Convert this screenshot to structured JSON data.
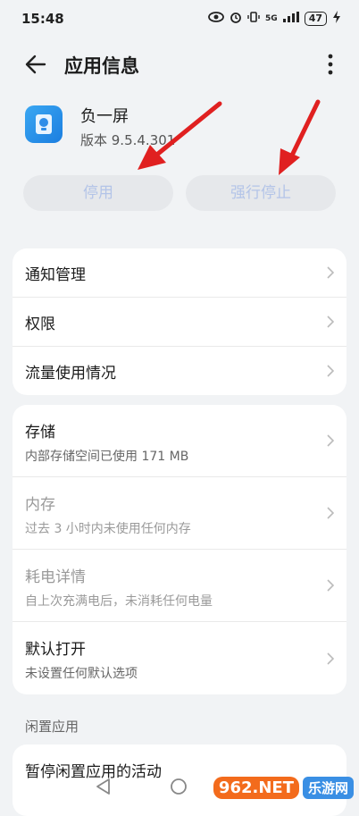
{
  "status_bar": {
    "time": "15:48",
    "network": "5G",
    "battery": "47"
  },
  "header": {
    "title": "应用信息"
  },
  "app": {
    "name": "负一屏",
    "version": "版本 9.5.4.301"
  },
  "actions": {
    "disable": "停用",
    "force_stop": "强行停止"
  },
  "card1": [
    {
      "label": "通知管理"
    },
    {
      "label": "权限"
    },
    {
      "label": "流量使用情况"
    }
  ],
  "card2": [
    {
      "label": "存储",
      "sub": "内部存储空间已使用 171 MB"
    },
    {
      "label": "内存",
      "sub": "过去 3 小时内未使用任何内存"
    },
    {
      "label": "耗电详情",
      "sub": "自上次充满电后，未消耗任何电量"
    },
    {
      "label": "默认打开",
      "sub": "未设置任何默认选项"
    }
  ],
  "section": {
    "title": "闲置应用"
  },
  "card3": {
    "label": "暂停闲置应用的活动"
  },
  "watermark": {
    "text1": "962.NET",
    "text2": "乐游网"
  },
  "colors": {
    "accent": "#3b7de8",
    "button_text": "#b3c4e8",
    "arrow": "#e02020"
  }
}
